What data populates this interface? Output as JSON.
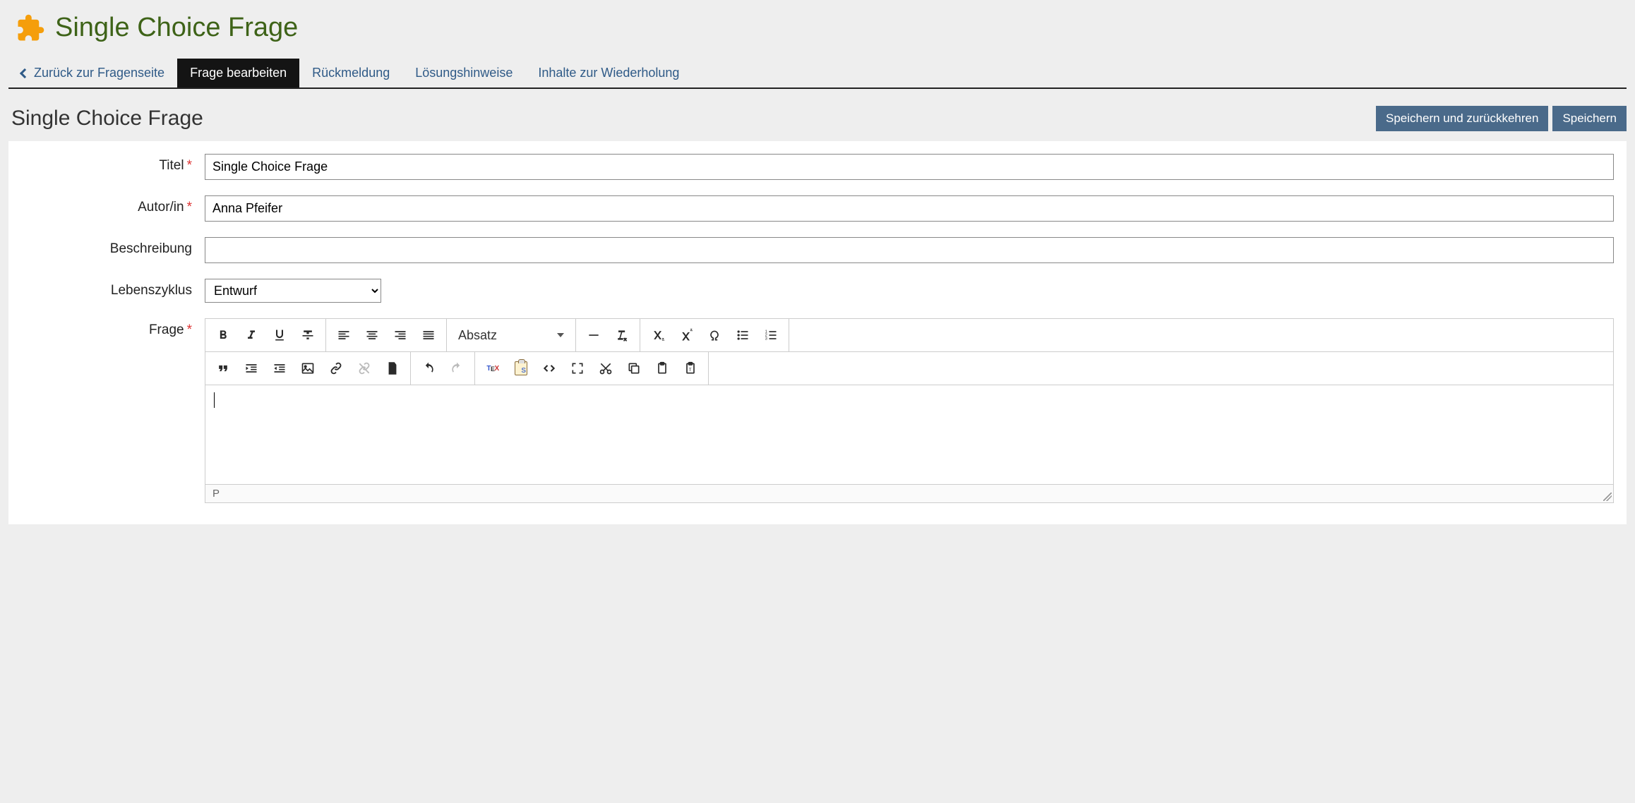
{
  "header": {
    "title": "Single Choice Frage"
  },
  "tabs": {
    "back": "Zurück zur Fragenseite",
    "edit": "Frage bearbeiten",
    "feedback": "Rückmeldung",
    "hints": "Lösungshinweise",
    "recap": "Inhalte zur Wiederholung"
  },
  "form": {
    "title": "Single Choice Frage",
    "buttons": {
      "save_return": "Speichern und zurückkehren",
      "save": "Speichern"
    },
    "labels": {
      "title": "Titel",
      "author": "Autor/in",
      "description": "Beschreibung",
      "lifecycle": "Lebenszyklus",
      "question": "Frage"
    },
    "values": {
      "title": "Single Choice Frage",
      "author": "Anna Pfeifer",
      "description": "",
      "lifecycle": "Entwurf"
    }
  },
  "editor": {
    "format": "Absatz",
    "path": "P"
  }
}
